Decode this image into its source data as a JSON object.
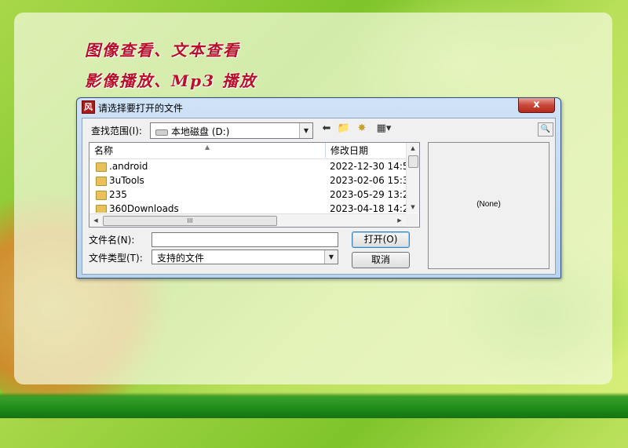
{
  "banner": {
    "line1": "图像查看、文本查看",
    "line2": "影像播放、Mp3 播放"
  },
  "dialog": {
    "title": "请选择要打开的文件",
    "app_icon": "风",
    "close_label": "x",
    "look_in_label": "查找范围(I):",
    "look_in_value": "本地磁盘 (D:)",
    "columns": {
      "name": "名称",
      "date": "修改日期"
    },
    "files": [
      {
        "name": ".android",
        "date": "2022-12-30 14:5"
      },
      {
        "name": "3uTools",
        "date": "2023-02-06 15:3"
      },
      {
        "name": "235",
        "date": "2023-05-29 13:2"
      },
      {
        "name": "360Downloads",
        "date": "2023-04-18 14:2"
      }
    ],
    "filename_label": "文件名(N):",
    "filename_value": "",
    "filetype_label": "文件类型(T):",
    "filetype_value": "支持的文件",
    "open_button": "打开(O)",
    "cancel_button": "取消",
    "preview_text": "(None)",
    "hscroll_grip": "III"
  },
  "icons": {
    "back": "back-arrow-icon",
    "up_folder": "up-folder-icon",
    "new_folder": "new-folder-icon",
    "view_menu": "view-menu-icon",
    "preview_toggle": "preview-icon",
    "folder": "folder-icon",
    "drive": "drive-icon"
  },
  "colors": {
    "headline": "#b8102a",
    "titlebar": "#cfe2f6",
    "close": "#c9483a",
    "background_green": "#7ec42a"
  }
}
